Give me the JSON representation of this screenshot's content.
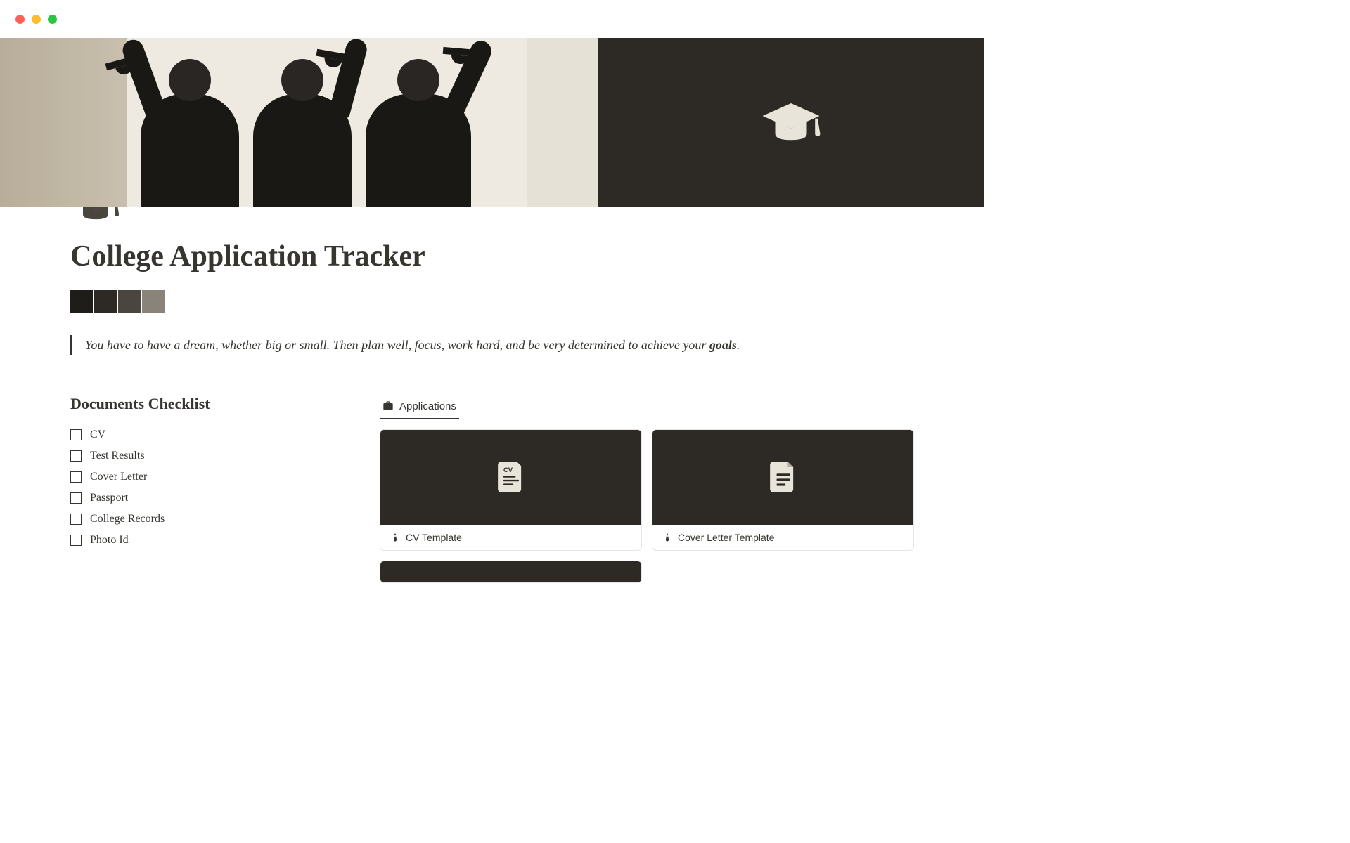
{
  "page": {
    "title": "College Application Tracker",
    "quote_pre": "You have to have a dream, whether big or small. Then plan well, focus, work hard, and be very determined to achieve your ",
    "quote_bold": "goals",
    "quote_post": "."
  },
  "swatches": [
    "#1f1d1a",
    "#2d2a26",
    "#4a453e",
    "#8a837a"
  ],
  "checklist": {
    "heading": "Documents Checklist",
    "items": [
      "CV",
      "Test Results",
      "Cover Letter",
      "Passport",
      "College Records",
      "Photo Id"
    ]
  },
  "applications": {
    "tab_label": "Applications",
    "cards": [
      {
        "title": "CV Template",
        "icon": "cv"
      },
      {
        "title": "Cover Letter Template",
        "icon": "doc"
      }
    ]
  }
}
